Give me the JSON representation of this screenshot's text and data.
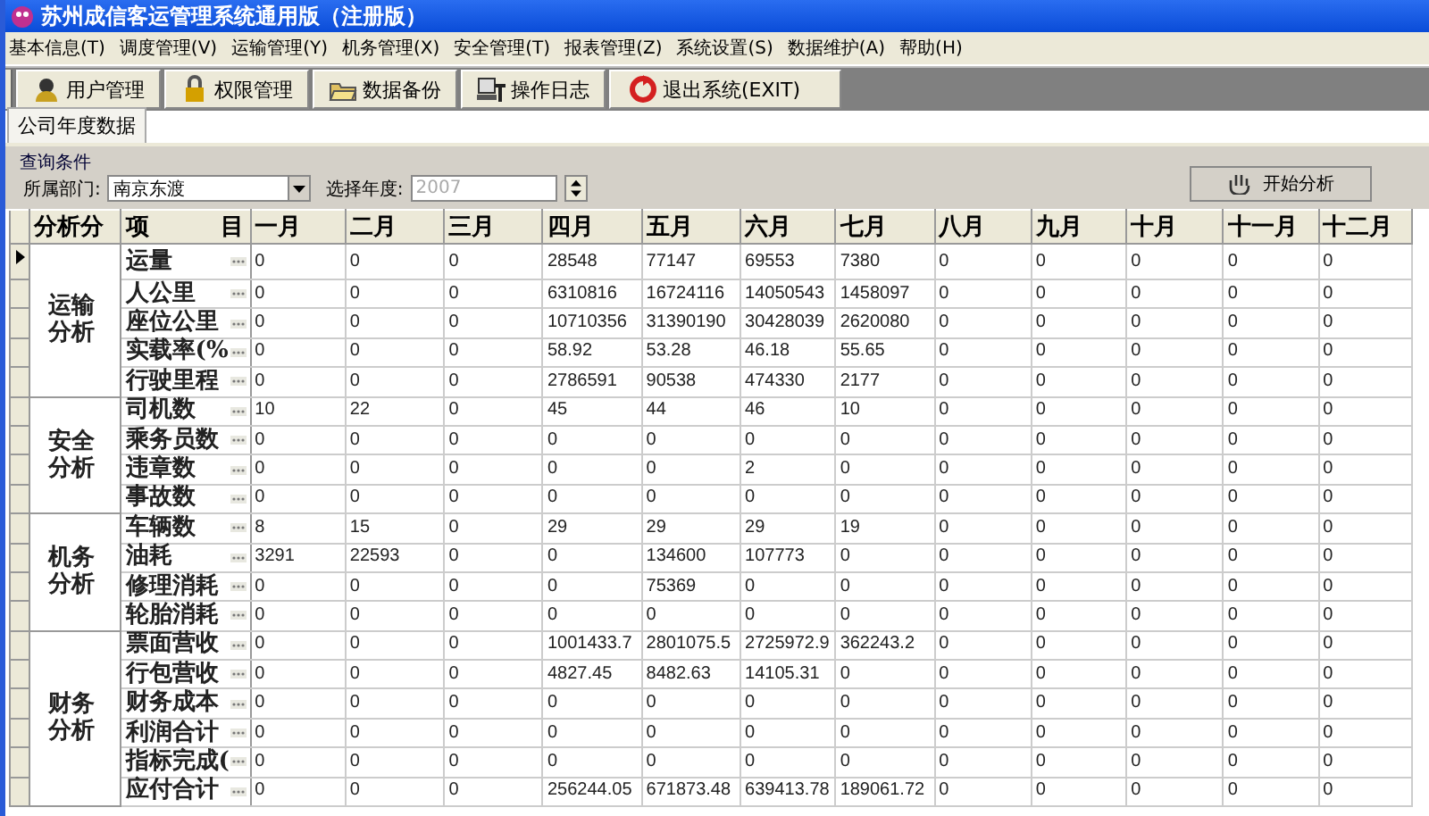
{
  "window": {
    "title": "苏州成信客运管理系统通用版（注册版）"
  },
  "menu": [
    "基本信息(T)",
    "调度管理(V)",
    "运输管理(Y)",
    "机务管理(X)",
    "安全管理(T)",
    "报表管理(Z)",
    "系统设置(S)",
    "数据维护(A)",
    "帮助(H)"
  ],
  "toolbar": [
    "用户管理",
    "权限管理",
    "数据备份",
    "操作日志",
    "退出系统(EXIT)"
  ],
  "tabs": [
    {
      "label": "公司年度数据",
      "selected": true
    }
  ],
  "query": {
    "title": "查询条件",
    "department": {
      "label": "所属部门:",
      "value": "南京东渡"
    },
    "year": {
      "label": "选择年度:",
      "value": "2007",
      "disabled": true
    },
    "button": "开始分析"
  },
  "grid": {
    "columns": [
      "分析分",
      "项 目",
      "一月",
      "二月",
      "三月",
      "四月",
      "五月",
      "六月",
      "七月",
      "八月",
      "九月",
      "十月",
      "十一月",
      "十二月"
    ],
    "groups": [
      {
        "category": "运输分析",
        "rows": [
          {
            "item": "运量",
            "selected": true,
            "values": [
              "0",
              "0",
              "0",
              "28548",
              "77147",
              "69553",
              "7380",
              "0",
              "0",
              "0",
              "0",
              "0"
            ]
          },
          {
            "item": "人公里",
            "selected": false,
            "values": [
              "0",
              "0",
              "0",
              "6310816",
              "16724116",
              "14050543",
              "1458097",
              "0",
              "0",
              "0",
              "0",
              "0"
            ]
          },
          {
            "item": "座位公里",
            "selected": false,
            "values": [
              "0",
              "0",
              "0",
              "10710356",
              "31390190",
              "30428039",
              "2620080",
              "0",
              "0",
              "0",
              "0",
              "0"
            ]
          },
          {
            "item": "实载率(%",
            "selected": false,
            "values": [
              "0",
              "0",
              "0",
              "58.92",
              "53.28",
              "46.18",
              "55.65",
              "0",
              "0",
              "0",
              "0",
              "0"
            ]
          },
          {
            "item": "行驶里程",
            "selected": false,
            "values": [
              "0",
              "0",
              "0",
              "2786591",
              "90538",
              "474330",
              "2177",
              "0",
              "0",
              "0",
              "0",
              "0"
            ]
          }
        ]
      },
      {
        "category": "安全分析",
        "rows": [
          {
            "item": "司机数",
            "selected": false,
            "values": [
              "10",
              "22",
              "0",
              "45",
              "44",
              "46",
              "10",
              "0",
              "0",
              "0",
              "0",
              "0"
            ]
          },
          {
            "item": "乘务员数",
            "selected": false,
            "values": [
              "0",
              "0",
              "0",
              "0",
              "0",
              "0",
              "0",
              "0",
              "0",
              "0",
              "0",
              "0"
            ]
          },
          {
            "item": "违章数",
            "selected": false,
            "values": [
              "0",
              "0",
              "0",
              "0",
              "0",
              "2",
              "0",
              "0",
              "0",
              "0",
              "0",
              "0"
            ]
          },
          {
            "item": "事故数",
            "selected": false,
            "values": [
              "0",
              "0",
              "0",
              "0",
              "0",
              "0",
              "0",
              "0",
              "0",
              "0",
              "0",
              "0"
            ]
          }
        ]
      },
      {
        "category": "机务分析",
        "rows": [
          {
            "item": "车辆数",
            "selected": false,
            "values": [
              "8",
              "15",
              "0",
              "29",
              "29",
              "29",
              "19",
              "0",
              "0",
              "0",
              "0",
              "0"
            ]
          },
          {
            "item": "油耗",
            "selected": false,
            "values": [
              "3291",
              "22593",
              "0",
              "0",
              "134600",
              "107773",
              "0",
              "0",
              "0",
              "0",
              "0",
              "0"
            ]
          },
          {
            "item": "修理消耗",
            "selected": false,
            "values": [
              "0",
              "0",
              "0",
              "0",
              "75369",
              "0",
              "0",
              "0",
              "0",
              "0",
              "0",
              "0"
            ]
          },
          {
            "item": "轮胎消耗",
            "selected": false,
            "values": [
              "0",
              "0",
              "0",
              "0",
              "0",
              "0",
              "0",
              "0",
              "0",
              "0",
              "0",
              "0"
            ]
          }
        ]
      },
      {
        "category": "财务分析",
        "rows": [
          {
            "item": "票面营收",
            "selected": false,
            "values": [
              "0",
              "0",
              "0",
              "1001433.7",
              "2801075.5",
              "2725972.9",
              "362243.2",
              "0",
              "0",
              "0",
              "0",
              "0"
            ]
          },
          {
            "item": "行包营收",
            "selected": false,
            "values": [
              "0",
              "0",
              "0",
              "4827.45",
              "8482.63",
              "14105.31",
              "0",
              "0",
              "0",
              "0",
              "0",
              "0"
            ]
          },
          {
            "item": "财务成本",
            "selected": false,
            "values": [
              "0",
              "0",
              "0",
              "0",
              "0",
              "0",
              "0",
              "0",
              "0",
              "0",
              "0",
              "0"
            ]
          },
          {
            "item": "利润合计",
            "selected": false,
            "values": [
              "0",
              "0",
              "0",
              "0",
              "0",
              "0",
              "0",
              "0",
              "0",
              "0",
              "0",
              "0"
            ]
          },
          {
            "item": "指标完成(",
            "selected": false,
            "values": [
              "0",
              "0",
              "0",
              "0",
              "0",
              "0",
              "0",
              "0",
              "0",
              "0",
              "0",
              "0"
            ]
          },
          {
            "item": "应付合计",
            "selected": false,
            "values": [
              "0",
              "0",
              "0",
              "256244.05",
              "671873.48",
              "639413.78",
              "189061.72",
              "0",
              "0",
              "0",
              "0",
              "0"
            ]
          }
        ]
      }
    ]
  }
}
